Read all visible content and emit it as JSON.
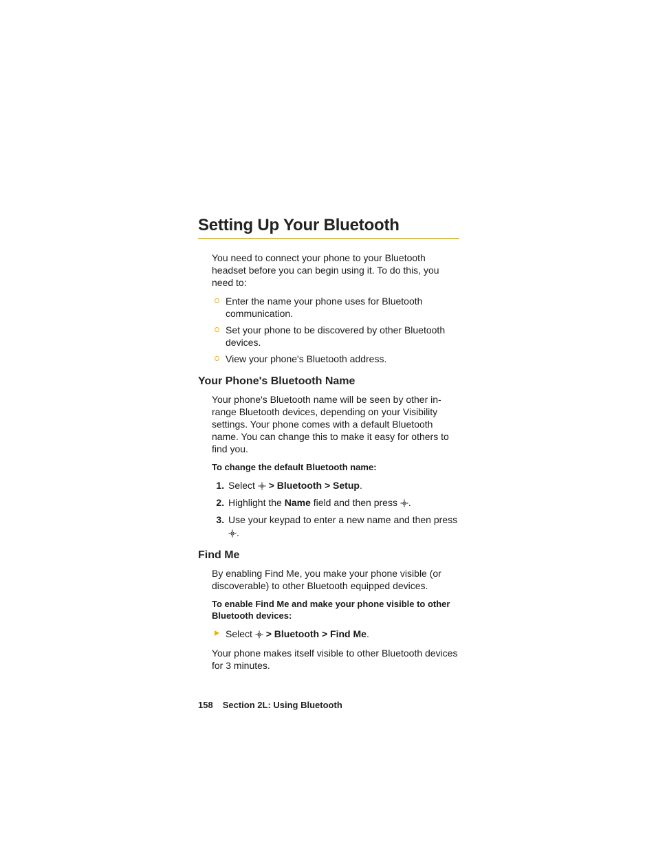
{
  "title": "Setting Up Your Bluetooth",
  "intro": "You need to connect your phone to your Bluetooth headset before you can begin using it. To do this, you need to:",
  "introBullets": [
    "Enter the name your phone uses for Bluetooth communication.",
    "Set your phone to be discovered by other Bluetooth devices.",
    "View your phone's Bluetooth address."
  ],
  "s1": {
    "heading": "Your Phone's Bluetooth Name",
    "para": "Your phone's Bluetooth name will be seen by other in-range Bluetooth devices, depending on your Visibility settings. Your phone comes with a default Bluetooth name. You can change this to make it easy for others to find you.",
    "lead": "To change the default Bluetooth name:",
    "step1_a": "Select ",
    "step1_b": " > ",
    "step1_c": "Bluetooth > Setup",
    "step1_d": ".",
    "step2_a": "Highlight the ",
    "step2_b": "Name",
    "step2_c": " field and then press ",
    "step2_d": ".",
    "step3_a": "Use your keypad to enter a new name and then press ",
    "step3_b": "."
  },
  "s2": {
    "heading": "Find Me",
    "para": "By enabling Find Me, you make your phone visible (or discoverable) to other Bluetooth equipped devices.",
    "lead": "To enable Find Me and make your phone visible to other Bluetooth devices:",
    "bullet_a": "Select ",
    "bullet_b": " > ",
    "bullet_c": "Bluetooth > Find Me",
    "bullet_d": ".",
    "after": "Your phone makes itself visible to other Bluetooth devices for 3 minutes."
  },
  "footer": {
    "page": "158",
    "section": "Section 2L: Using Bluetooth"
  }
}
